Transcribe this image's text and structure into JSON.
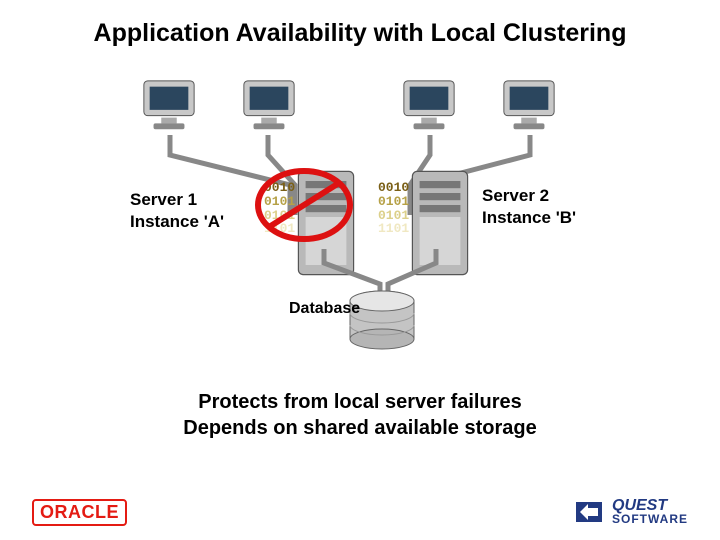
{
  "title": "Application Availability with Local Clustering",
  "server1": {
    "line1": "Server 1",
    "line2": "Instance 'A'"
  },
  "server2": {
    "line1": "Server 2",
    "line2": "Instance 'B'"
  },
  "binary": {
    "l1": "0010",
    "l2": "0101",
    "l3": "0101",
    "l4": "1101"
  },
  "database_label": "Database",
  "bottom": {
    "l1": "Protects from local server failures",
    "l2": "Depends on shared available storage"
  },
  "logos": {
    "oracle": "ORACLE",
    "quest_l1": "QUEST",
    "quest_l2": "SOFTWARE"
  }
}
